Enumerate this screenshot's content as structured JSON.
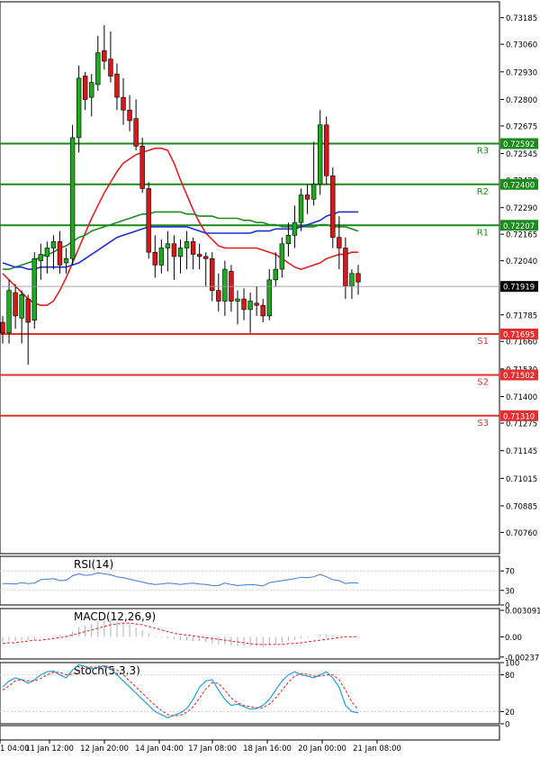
{
  "chart_data": {
    "type": "candlestick",
    "price_ylim": [
      0.7066,
      0.7326
    ],
    "price_ticks": [
      "0.73185",
      "0.73060",
      "0.72930",
      "0.72800",
      "0.72675",
      "0.72545",
      "0.72420",
      "0.72290",
      "0.72165",
      "0.72040",
      "0.71910",
      "0.71785",
      "0.71660",
      "0.71530",
      "0.71400",
      "0.71275",
      "0.71145",
      "0.71015",
      "0.70885",
      "0.70760"
    ],
    "current_price": "0.71919",
    "levels": [
      {
        "name": "R3",
        "value": 0.72592,
        "label": "0.72592",
        "color": "#1a8a1a"
      },
      {
        "name": "R2",
        "value": 0.724,
        "label": "0.72400",
        "color": "#1a8a1a"
      },
      {
        "name": "R1",
        "value": 0.72207,
        "label": "0.72207",
        "color": "#1a8a1a"
      },
      {
        "name": "S1",
        "value": 0.71695,
        "label": "0.71695",
        "color": "#e03030"
      },
      {
        "name": "S2",
        "value": 0.71502,
        "label": "0.71502",
        "color": "#e03030"
      },
      {
        "name": "S3",
        "value": 0.7131,
        "label": "0.71310",
        "color": "#e03030"
      }
    ],
    "candles": [
      [
        0.7175,
        0.7178,
        0.7165,
        0.717
      ],
      [
        0.717,
        0.7195,
        0.7165,
        0.719
      ],
      [
        0.7189,
        0.7193,
        0.7172,
        0.7178
      ],
      [
        0.7177,
        0.719,
        0.7165,
        0.7188
      ],
      [
        0.7186,
        0.7188,
        0.7155,
        0.7175
      ],
      [
        0.7176,
        0.7208,
        0.7172,
        0.7205
      ],
      [
        0.7204,
        0.7212,
        0.7195,
        0.7207
      ],
      [
        0.7206,
        0.7213,
        0.7198,
        0.721
      ],
      [
        0.721,
        0.7216,
        0.72,
        0.7213
      ],
      [
        0.7213,
        0.7218,
        0.7198,
        0.7202
      ],
      [
        0.7203,
        0.721,
        0.7198,
        0.7205
      ],
      [
        0.7205,
        0.7268,
        0.7202,
        0.7262
      ],
      [
        0.7262,
        0.7296,
        0.7255,
        0.729
      ],
      [
        0.7291,
        0.7293,
        0.7275,
        0.728
      ],
      [
        0.7281,
        0.7292,
        0.7272,
        0.7288
      ],
      [
        0.7287,
        0.731,
        0.7284,
        0.7302
      ],
      [
        0.7303,
        0.7315,
        0.7294,
        0.7298
      ],
      [
        0.7299,
        0.7312,
        0.7288,
        0.7291
      ],
      [
        0.7292,
        0.7297,
        0.7275,
        0.7281
      ],
      [
        0.7281,
        0.729,
        0.7268,
        0.7275
      ],
      [
        0.7275,
        0.7282,
        0.7265,
        0.727
      ],
      [
        0.7271,
        0.728,
        0.7256,
        0.7258
      ],
      [
        0.7258,
        0.7262,
        0.7236,
        0.7238
      ],
      [
        0.7238,
        0.7241,
        0.7205,
        0.7208
      ],
      [
        0.7208,
        0.7216,
        0.7196,
        0.7202
      ],
      [
        0.7202,
        0.7214,
        0.7198,
        0.721
      ],
      [
        0.721,
        0.7218,
        0.7199,
        0.7212
      ],
      [
        0.7212,
        0.7216,
        0.7195,
        0.7206
      ],
      [
        0.7206,
        0.7214,
        0.7198,
        0.721
      ],
      [
        0.721,
        0.7218,
        0.72,
        0.7213
      ],
      [
        0.7213,
        0.7215,
        0.72,
        0.7207
      ],
      [
        0.7207,
        0.7212,
        0.72,
        0.7206
      ],
      [
        0.7206,
        0.7208,
        0.7192,
        0.7205
      ],
      [
        0.7205,
        0.7208,
        0.7185,
        0.719
      ],
      [
        0.719,
        0.7198,
        0.718,
        0.7185
      ],
      [
        0.7185,
        0.7204,
        0.7178,
        0.72
      ],
      [
        0.7199,
        0.7202,
        0.718,
        0.7185
      ],
      [
        0.7185,
        0.719,
        0.7174,
        0.7186
      ],
      [
        0.7186,
        0.7191,
        0.7176,
        0.7181
      ],
      [
        0.7181,
        0.7189,
        0.717,
        0.7185
      ],
      [
        0.7184,
        0.7192,
        0.7178,
        0.7183
      ],
      [
        0.7183,
        0.7186,
        0.7175,
        0.7178
      ],
      [
        0.7178,
        0.72,
        0.7176,
        0.7195
      ],
      [
        0.7195,
        0.7208,
        0.7192,
        0.72
      ],
      [
        0.72,
        0.7215,
        0.7196,
        0.7212
      ],
      [
        0.7212,
        0.7222,
        0.7206,
        0.7216
      ],
      [
        0.7216,
        0.723,
        0.721,
        0.7222
      ],
      [
        0.7222,
        0.7238,
        0.7218,
        0.7235
      ],
      [
        0.7235,
        0.724,
        0.7226,
        0.7233
      ],
      [
        0.7233,
        0.726,
        0.723,
        0.724
      ],
      [
        0.724,
        0.7275,
        0.7235,
        0.7268
      ],
      [
        0.7268,
        0.7272,
        0.724,
        0.7244
      ],
      [
        0.7244,
        0.7248,
        0.721,
        0.7215
      ],
      [
        0.7215,
        0.7225,
        0.72,
        0.721
      ],
      [
        0.721,
        0.7215,
        0.7186,
        0.7192
      ],
      [
        0.7192,
        0.72,
        0.7186,
        0.7198
      ],
      [
        0.7198,
        0.7202,
        0.7188,
        0.7194
      ]
    ],
    "series": [
      {
        "name": "",
        "color": "#e02020",
        "values": [
          0.7198,
          0.7195,
          0.7192,
          0.7189,
          0.7186,
          0.7184,
          0.7183,
          0.7183,
          0.7185,
          0.719,
          0.7196,
          0.7203,
          0.721,
          0.7217,
          0.7224,
          0.723,
          0.7236,
          0.7241,
          0.7246,
          0.725,
          0.7252,
          0.7254,
          0.7255,
          0.7256,
          0.7257,
          0.7257,
          0.7256,
          0.725,
          0.7242,
          0.7235,
          0.7228,
          0.7222,
          0.7217,
          0.7214,
          0.7211,
          0.721,
          0.721,
          0.721,
          0.721,
          0.721,
          0.721,
          0.7209,
          0.7208,
          0.7207,
          0.7205,
          0.7203,
          0.7201,
          0.72,
          0.7201,
          0.7202,
          0.7203,
          0.7205,
          0.7206,
          0.7207,
          0.7207,
          0.7208,
          0.7208
        ]
      },
      {
        "name": "",
        "color": "#1e8c1e",
        "values": [
          0.72,
          0.72,
          0.7201,
          0.7202,
          0.7203,
          0.7204,
          0.7206,
          0.7207,
          0.7208,
          0.721,
          0.7211,
          0.7213,
          0.7215,
          0.7216,
          0.7218,
          0.7219,
          0.722,
          0.7221,
          0.7222,
          0.7223,
          0.7224,
          0.7225,
          0.7226,
          0.7226,
          0.7227,
          0.7227,
          0.7227,
          0.7227,
          0.7227,
          0.7226,
          0.7226,
          0.7225,
          0.7225,
          0.7225,
          0.7224,
          0.7224,
          0.7224,
          0.7224,
          0.7223,
          0.7223,
          0.7222,
          0.7222,
          0.7221,
          0.7221,
          0.722,
          0.722,
          0.722,
          0.722,
          0.722,
          0.722,
          0.7221,
          0.7221,
          0.722,
          0.722,
          0.722,
          0.7219,
          0.7218
        ]
      },
      {
        "name": "",
        "color": "#1f2fd0",
        "values": [
          0.7203,
          0.7202,
          0.7201,
          0.7201,
          0.72,
          0.72,
          0.7201,
          0.7201,
          0.7201,
          0.7201,
          0.7201,
          0.7202,
          0.7203,
          0.7205,
          0.7207,
          0.7209,
          0.7211,
          0.7213,
          0.7215,
          0.7216,
          0.7217,
          0.7218,
          0.7219,
          0.722,
          0.722,
          0.722,
          0.722,
          0.722,
          0.722,
          0.722,
          0.7219,
          0.7218,
          0.7217,
          0.7217,
          0.7217,
          0.7217,
          0.7217,
          0.7217,
          0.7217,
          0.7217,
          0.7218,
          0.7218,
          0.7218,
          0.7219,
          0.7219,
          0.7219,
          0.7219,
          0.722,
          0.7221,
          0.7222,
          0.7223,
          0.7225,
          0.7226,
          0.7227,
          0.7227,
          0.7227,
          0.7227
        ]
      }
    ],
    "rsi": {
      "title": "RSI(14)",
      "ylim": [
        0,
        100
      ],
      "ticks": [
        "70",
        "30",
        "0"
      ],
      "values": [
        44,
        44,
        43,
        46,
        44,
        45,
        52,
        53,
        54,
        50,
        51,
        60,
        64,
        61,
        62,
        66,
        64,
        62,
        58,
        56,
        53,
        50,
        47,
        44,
        42,
        43,
        45,
        44,
        42,
        44,
        45,
        43,
        42,
        40,
        40,
        45,
        42,
        40,
        41,
        42,
        41,
        39,
        46,
        48,
        50,
        52,
        54,
        57,
        56,
        58,
        63,
        58,
        52,
        50,
        44,
        46,
        45
      ]
    },
    "macd": {
      "title": "MACD(12,26,9)",
      "ylim": [
        -0.0026,
        0.0033
      ],
      "ticks": [
        "0.003091",
        "0.00",
        "-0.002371"
      ],
      "hist": [
        -0.0006,
        -0.0005,
        -0.0005,
        -0.0004,
        -0.0004,
        -0.0003,
        -0.0001,
        0.0,
        0.0001,
        0.0002,
        0.0002,
        0.0006,
        0.0011,
        0.0013,
        0.0015,
        0.0018,
        0.0019,
        0.0019,
        0.0018,
        0.0016,
        0.0014,
        0.0011,
        0.0008,
        0.0004,
        0.0001,
        -0.0001,
        -0.0002,
        -0.0003,
        -0.0004,
        -0.0004,
        -0.0005,
        -0.0005,
        -0.0006,
        -0.0008,
        -0.0009,
        -0.0009,
        -0.001,
        -0.0011,
        -0.0011,
        -0.0011,
        -0.0011,
        -0.0012,
        -0.001,
        -0.0009,
        -0.0007,
        -0.0005,
        -0.0004,
        -0.0002,
        -0.0001,
        0.0,
        0.0003,
        0.0003,
        0.0002,
        0.0001,
        -0.0001,
        -0.0001,
        -0.0001
      ],
      "signal": [
        -0.0008,
        -0.0007,
        -0.0007,
        -0.0006,
        -0.0005,
        -0.0004,
        -0.0004,
        -0.0003,
        -0.0002,
        -0.0001,
        0.0,
        0.0002,
        0.0004,
        0.0006,
        0.0008,
        0.001,
        0.0012,
        0.0014,
        0.0015,
        0.0016,
        0.0016,
        0.0015,
        0.0014,
        0.0012,
        0.001,
        0.0008,
        0.0006,
        0.0004,
        0.0003,
        0.0002,
        0.0001,
        0.0,
        -0.0001,
        -0.0002,
        -0.0003,
        -0.0004,
        -0.0005,
        -0.0006,
        -0.0007,
        -0.0008,
        -0.0009,
        -0.0009,
        -0.0009,
        -0.0009,
        -0.0009,
        -0.0008,
        -0.0008,
        -0.0007,
        -0.0006,
        -0.0005,
        -0.0004,
        -0.0003,
        -0.0002,
        -0.0001,
        0.0,
        0.0,
        0.0
      ]
    },
    "stoch": {
      "title": "Stoch(5,3,3)",
      "ylim": [
        0,
        100
      ],
      "ticks": [
        "100",
        "80",
        "20",
        "0"
      ],
      "k": [
        60,
        70,
        75,
        72,
        66,
        72,
        80,
        85,
        86,
        80,
        75,
        88,
        96,
        94,
        90,
        92,
        95,
        90,
        80,
        70,
        60,
        50,
        40,
        30,
        20,
        15,
        10,
        14,
        18,
        25,
        40,
        60,
        70,
        72,
        55,
        40,
        30,
        32,
        28,
        24,
        25,
        30,
        40,
        55,
        70,
        80,
        85,
        80,
        78,
        75,
        80,
        85,
        75,
        60,
        30,
        20,
        18
      ],
      "d": [
        55,
        62,
        70,
        72,
        70,
        70,
        74,
        80,
        84,
        84,
        80,
        81,
        87,
        92,
        93,
        92,
        93,
        92,
        88,
        80,
        70,
        60,
        50,
        40,
        30,
        22,
        15,
        13,
        14,
        19,
        28,
        42,
        57,
        67,
        66,
        55,
        42,
        34,
        30,
        28,
        26,
        26,
        32,
        42,
        55,
        68,
        78,
        82,
        81,
        78,
        78,
        80,
        80,
        72,
        55,
        36,
        23
      ]
    },
    "x_labels": [
      "1 04:00",
      "11 Jan 12:00",
      "12 Jan 20:00",
      "14 Jan 04:00",
      "17 Jan 08:00",
      "18 Jan 16:00",
      "20 Jan 00:00",
      "21 Jan 08:00"
    ]
  }
}
